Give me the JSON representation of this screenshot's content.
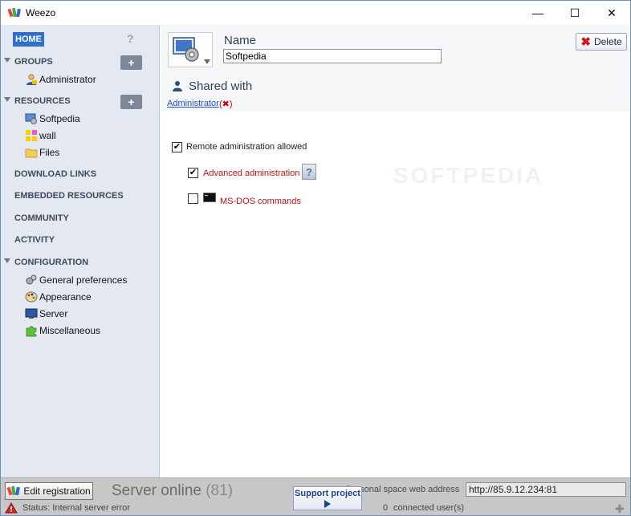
{
  "window": {
    "title": "Weezo",
    "minimize_glyph": "—",
    "maximize_glyph": "☐",
    "close_glyph": "✕"
  },
  "sidebar": {
    "home_label": "HOME",
    "help_glyph": "?",
    "add_glyph": "+",
    "groups": {
      "label": "GROUPS",
      "items": [
        {
          "label": "Administrator",
          "icon": "user-icon"
        }
      ]
    },
    "resources": {
      "label": "RESOURCES",
      "items": [
        {
          "label": "Softpedia",
          "icon": "computer-icon"
        },
        {
          "label": "wall",
          "icon": "wall-icon"
        },
        {
          "label": "Files",
          "icon": "folder-icon"
        }
      ]
    },
    "links": [
      {
        "label": "DOWNLOAD LINKS"
      },
      {
        "label": "EMBEDDED RESOURCES"
      },
      {
        "label": "COMMUNITY"
      },
      {
        "label": "ACTIVITY"
      }
    ],
    "configuration": {
      "label": "CONFIGURATION",
      "items": [
        {
          "label": "General preferences",
          "icon": "gears-icon"
        },
        {
          "label": "Appearance",
          "icon": "palette-icon"
        },
        {
          "label": "Server",
          "icon": "monitor-icon"
        },
        {
          "label": "Miscellaneous",
          "icon": "puzzle-icon"
        }
      ]
    }
  },
  "main": {
    "name_label": "Name",
    "name_value": "Softpedia",
    "delete_label": "Delete",
    "delete_glyph": "✖",
    "shared_with_label": "Shared with",
    "shared_user": "Administrator",
    "remove_glyph": "(✖)",
    "options": {
      "remote_admin": {
        "label": "Remote administration allowed",
        "checked": true
      },
      "advanced_admin": {
        "label": "Advanced administration",
        "checked": true
      },
      "msdos": {
        "label": "MS-DOS commands",
        "checked": false
      }
    },
    "check_glyph": "✔",
    "help_glyph": "?"
  },
  "bottombar": {
    "edit_registration_label": "Edit registration",
    "server_status": "Server online",
    "server_count": "(81)",
    "status_text": "Status: Internal server error",
    "support_label": "Support project",
    "web_address_label": "Personal space web address",
    "web_address_value": "http://85.9.12.234:81",
    "connected_count": "0",
    "connected_label": "connected user(s)",
    "grip_glyph": "✚"
  },
  "colors": {
    "sidebar_bg": "#e4e9f1",
    "home_highlight": "#2f6fc9",
    "bottom_bg": "#c7c7c7",
    "red_text": "#c41010"
  }
}
